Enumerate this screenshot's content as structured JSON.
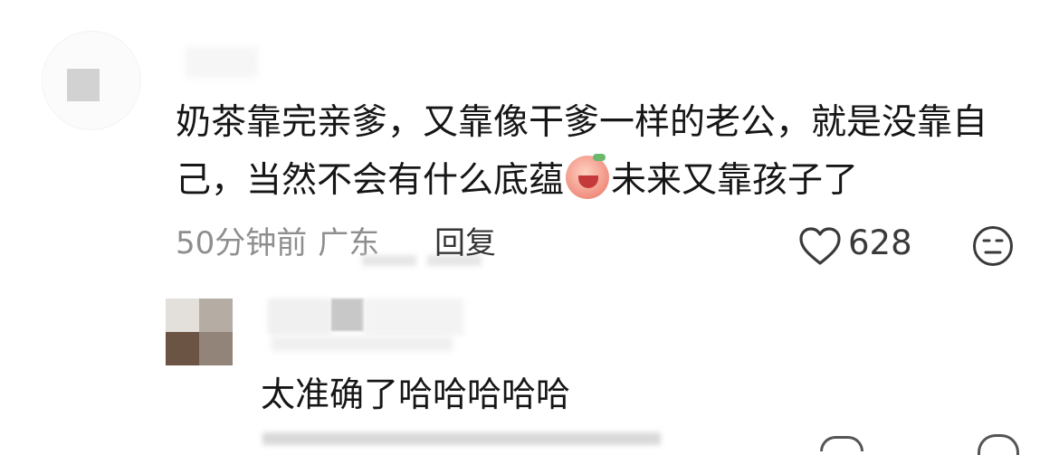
{
  "comment": {
    "text_part1": "奶茶靠完亲爹，又靠像干爹一样的老公，就是没靠自己，当然不会有什么底蕴",
    "emoji_icon": "crying-face-emoji",
    "text_part2": "未来又靠孩子了",
    "time": "50分钟前",
    "location": "广东",
    "reply_label": "回复",
    "like_count": "628",
    "like_icon": "heart-icon",
    "react_icon": "neutral-face-icon"
  },
  "reply_comment": {
    "text": "太准确了哈哈哈哈哈"
  },
  "colors": {
    "text": "#161616",
    "meta": "#8e8e8e",
    "icon": "#3a3a3a"
  }
}
